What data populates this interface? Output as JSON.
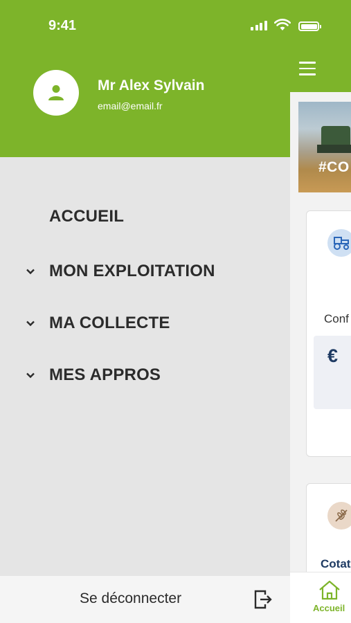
{
  "status_bar": {
    "time": "9:41"
  },
  "drawer": {
    "user": {
      "name": "Mr Alex Sylvain",
      "email": "email@email.fr"
    },
    "menu": [
      {
        "label": "ACCUEIL",
        "expandable": false
      },
      {
        "label": "MON EXPLOITATION",
        "expandable": true
      },
      {
        "label": "MA COLLECTE",
        "expandable": true
      },
      {
        "label": "MES APPROS",
        "expandable": true
      }
    ],
    "logout_label": "Se déconnecter"
  },
  "main": {
    "banner_text": "#CO",
    "card1": {
      "text": "Conf",
      "currency_symbol": "€",
      "icon": "tractor-icon"
    },
    "card2": {
      "text": "Cotat",
      "icon": "wheat-icon"
    },
    "tab": {
      "label": "Accueil",
      "icon": "home-icon"
    }
  },
  "colors": {
    "brand_green": "#7db42a",
    "drawer_bg": "#e5e5e5",
    "navy": "#1f3b63"
  }
}
